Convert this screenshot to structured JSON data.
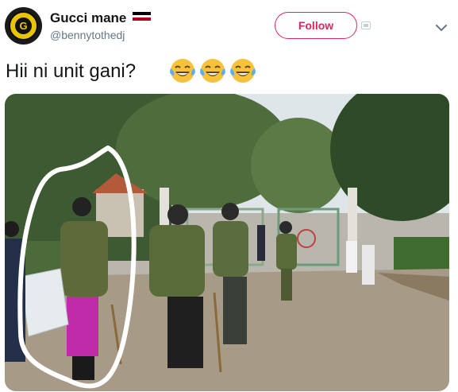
{
  "tweet": {
    "author_name": "Gucci mane",
    "handle": "@bennytothedj",
    "follow_label": "Follow",
    "text": "Hii ni unit gani?",
    "emoji_count": 3,
    "emoji_icon": "face-with-tears-of-joy-icon",
    "flag_icon": "kenya-flag-icon",
    "avatar_monogram": "G"
  },
  "colors": {
    "follow_accent": "#e0245e",
    "handle_gray": "#657786",
    "text": "#14171a",
    "emoji_yellow": "#f6c23c"
  },
  "photo": {
    "scene": "uniformed officers in camouflage at a gate on a paved road"
  }
}
